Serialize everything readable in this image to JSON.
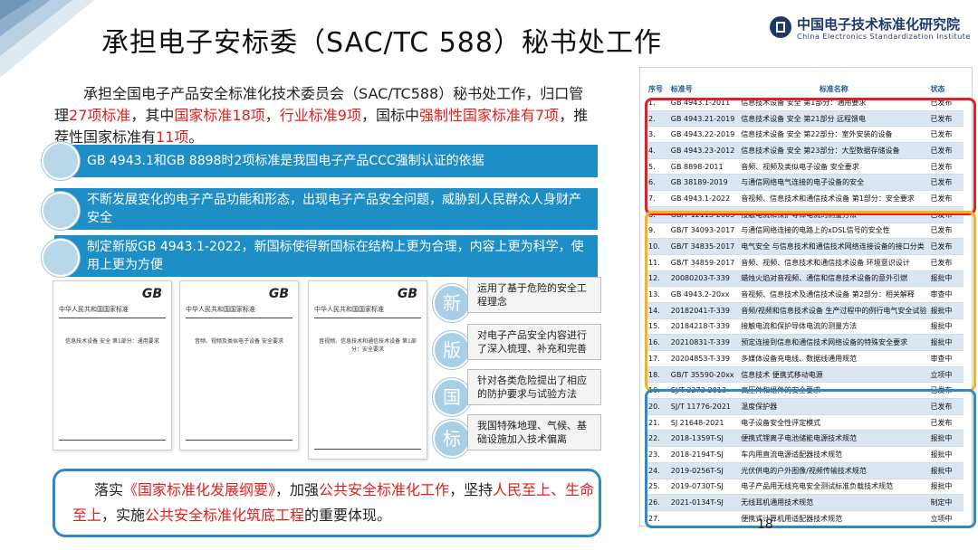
{
  "title": "承担电子安标委（SAC/TC 588）秘书处工作",
  "logo": {
    "name_cn": "中国电子技术标准化研究院",
    "name_en": "China Electronics Standardization Institute",
    "mark": "CESI"
  },
  "intro": {
    "p1": "承担全国电子产品安全标准化技术委员会（SAC/TC588）秘书处工作，",
    "p2": "归口管理",
    "p3": "27项标准",
    "p4": "，其中",
    "p5": "国家标准18项",
    "p6": "，",
    "p7": "行业标准9项",
    "p8": "，国标中",
    "p9": "强制性国家标准有7项",
    "p10": "，推荐性国家标准有",
    "p11": "11项",
    "p12": "。"
  },
  "bullets": [
    "GB 4943.1和GB 8898时2项标准是我国电子产品CCC强制认证的依据",
    "不断发展变化的电子产品功能和形态，出现电子产品安全问题，威胁到人民群众人身财产安全",
    "制定新版GB 4943.1-2022，新国标使得新国标在结构上更为合理，内容上更为科学，使用上更为方便"
  ],
  "docs": [
    {
      "title": "信息技术设备 安全 第1部分：通用要求"
    },
    {
      "title": "音频、视频及类似电子设备 安全要求"
    },
    {
      "title": "音视频、信息技术和通信技术设备 第1部分：安全要求"
    }
  ],
  "doc_header": "中华人民共和国国家标准",
  "doc_gb": "GB",
  "new_std": {
    "chars": [
      "新",
      "版",
      "国",
      "标"
    ],
    "notes": [
      "运用了基于危险的安全工程理念",
      "对电子产品安全内容进行了深入梳理、补充和完善",
      "针对各类危险提出了相应的防护要求与试验方法",
      "我国特殊地理、气候、基础设施加入技术偏离"
    ]
  },
  "statement": {
    "s1": "落实",
    "s2": "《国家标准化发展纲要》",
    "s3": "，加强",
    "s4": "公共安全标准化工作",
    "s5": "，坚持",
    "s6": "人民至上、生命至上",
    "s7": "，实施",
    "s8": "公共安全标准化筑底工程",
    "s9": "的重要体现。"
  },
  "table": {
    "headers": {
      "no": "序号",
      "code": "标准号",
      "name": "标准名称",
      "status": "状态"
    },
    "rows": [
      {
        "no": "1.",
        "code": "GB 4943.1-2011",
        "name": "信息技术设备 安全 第1部分：通用要求",
        "status": "已发布"
      },
      {
        "no": "2.",
        "code": "GB 4943.21-2019",
        "name": "信息技术设备 安全 第21部分 远程馈电",
        "status": "已发布"
      },
      {
        "no": "3.",
        "code": "GB 4943.22-2019",
        "name": "信息技术设备 安全 第22部分：室外安装的设备",
        "status": "已发布"
      },
      {
        "no": "4.",
        "code": "GB 4943.23-2012",
        "name": "信息技术设备 安全 第23部分：大型数据存储设备",
        "status": "已发布"
      },
      {
        "no": "5.",
        "code": "GB 8898-2011",
        "name": "音频、视频及类似电子设备 安全要求",
        "status": "已发布"
      },
      {
        "no": "6.",
        "code": "GB 38189-2019",
        "name": "与通信网络电气连接的电子设备的安全",
        "status": "已发布"
      },
      {
        "no": "7.",
        "code": "GB 4943.1-2022",
        "name": "音视频、信息技术和通信技术设备 第1部分：安全要求",
        "status": "已发布"
      },
      {
        "no": "8.",
        "code": "GB/T 12113-2003",
        "name": "接触电流和保护导体电流的测量方法",
        "status": "已发布"
      },
      {
        "no": "9.",
        "code": "GB/T 34093-2017",
        "name": "与通信网络连接的电路上的xDSL信号的安全性",
        "status": "已发布"
      },
      {
        "no": "10.",
        "code": "GB/T 34835-2017",
        "name": "电气安全 与信息技术和通信技术网络连接设备的接口分类",
        "status": "已发布"
      },
      {
        "no": "11.",
        "code": "GB/T 34859-2017",
        "name": "音频、视频、信息技术和通信技术设备 环境意识设计",
        "status": "已发布"
      },
      {
        "no": "12.",
        "code": "20080203-T-339",
        "name": "蜡烛火焰对音视频、通信和信息技术设备的意外引燃",
        "status": "报批中"
      },
      {
        "no": "13.",
        "code": "GB 4943.2-20xx",
        "name": "音视频、信息技术及通信技术设备 第2部分：相关解释",
        "status": "审查中"
      },
      {
        "no": "14.",
        "code": "20182041-T-339",
        "name": "音频/视频和信息技术设备 生产过程中的例行电气安全试验",
        "status": "报批中"
      },
      {
        "no": "15.",
        "code": "20184218-T-339",
        "name": "接触电流和保护导体电流的测量方法",
        "status": "报批中"
      },
      {
        "no": "16.",
        "code": "20210831-T-339",
        "name": "预定连接到信息和通信技术网络设备的特殊安全要求",
        "status": "报批中"
      },
      {
        "no": "17.",
        "code": "20204853-T-339",
        "name": "多媒体设备充电线、数据线通用规范",
        "status": "审查中"
      },
      {
        "no": "18.",
        "code": "GB/T 35590-20xx",
        "name": "信息技术 便携式移动电源",
        "status": "立项中"
      },
      {
        "no": "19.",
        "code": "SJ/T 3273-2013",
        "name": "高压件和组件的安全要求",
        "status": "已发布"
      },
      {
        "no": "20.",
        "code": "SJ/T 11776-2021",
        "name": "温度保护器",
        "status": "已发布"
      },
      {
        "no": "21.",
        "code": "SJ 21648-2021",
        "name": "电子设备安全性评定模式",
        "status": "已发布"
      },
      {
        "no": "22.",
        "code": "2018-1359T-SJ",
        "name": "便携式锂离子电池储能电源技术规范",
        "status": "报批中"
      },
      {
        "no": "23.",
        "code": "2018-2194T-SJ",
        "name": "车内用直流电源适配器技术规范",
        "status": "报批中"
      },
      {
        "no": "24.",
        "code": "2019-0256T-SJ",
        "name": "光伏供电的户外图像/视频传输技术规范",
        "status": "报批中"
      },
      {
        "no": "25.",
        "code": "2019-0730T-SJ",
        "name": "电子产品用无线充电安全测试标准负载技术规范",
        "status": "报批中"
      },
      {
        "no": "26.",
        "code": "2021-0134T-SJ",
        "name": "无线耳机通用技术规范",
        "status": "制定中"
      },
      {
        "no": "27.",
        "code": "",
        "name": "便携式计算机用适配器技术规范",
        "status": "立项中"
      }
    ]
  },
  "page_number": "18",
  "colors": {
    "accent_blue": "#1e8fc6",
    "highlight_red": "#e0201c",
    "group_red": "#e21f26",
    "group_orange": "#f3b51a",
    "group_blue": "#2f88c8"
  }
}
